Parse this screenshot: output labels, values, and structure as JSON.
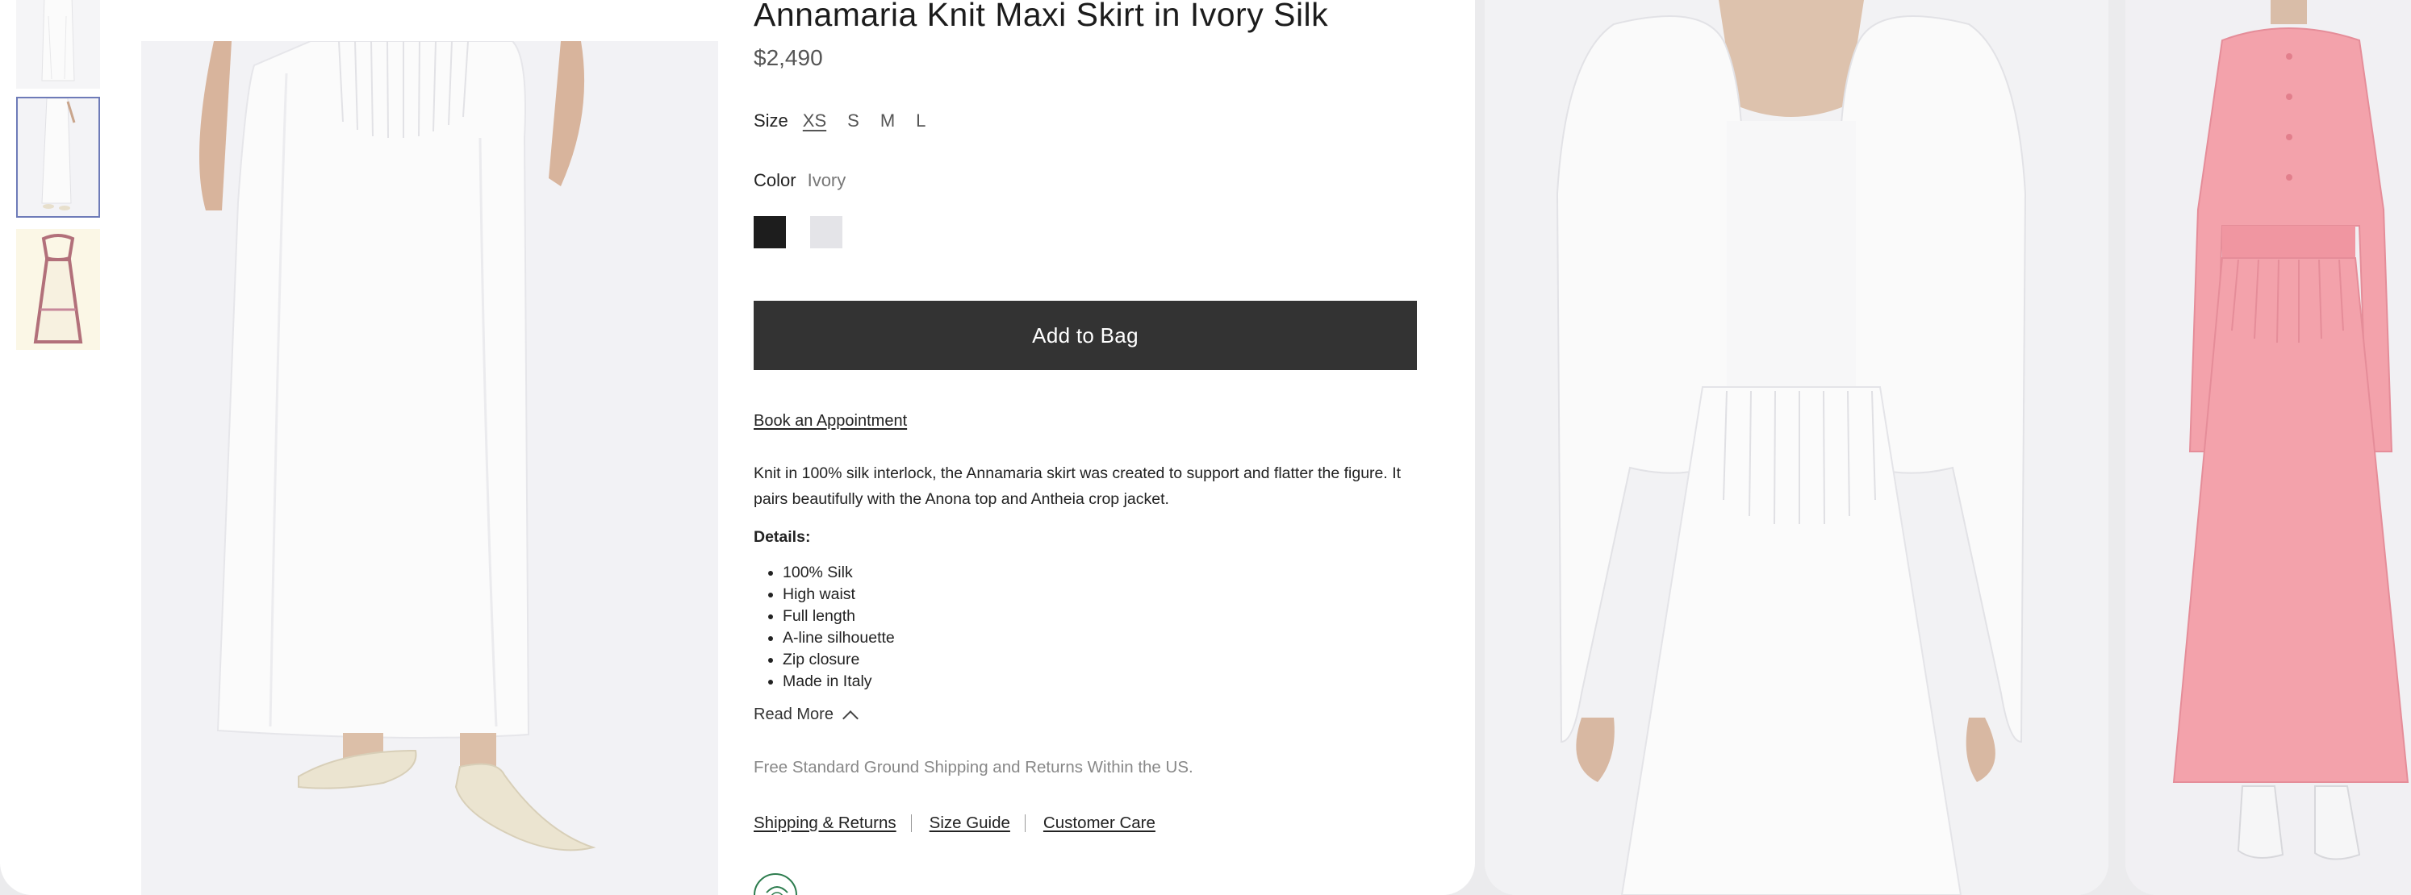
{
  "product": {
    "title": "Annamaria Knit Maxi Skirt in Ivory Silk",
    "price": "$2,490",
    "size_label": "Size",
    "sizes": [
      "XS",
      "S",
      "M",
      "L"
    ],
    "selected_size": "XS",
    "color_label": "Color",
    "color_value": "Ivory",
    "swatches": [
      {
        "name": "black",
        "hex": "#1d1d1d"
      },
      {
        "name": "ivory",
        "hex": "#e4e4e8"
      }
    ],
    "add_to_bag": "Add to Bag",
    "book_appointment": "Book an Appointment",
    "description": "Knit in 100% silk interlock, the Annamaria skirt was created to support and flatter the figure. It pairs beautifully with the Anona top and Antheia crop jacket.",
    "details_heading": "Details:",
    "details": [
      "100% Silk",
      "High waist",
      "Full length",
      "A-line silhouette",
      "Zip closure",
      "Made in Italy"
    ],
    "read_more": "Read More",
    "shipping_note": "Free Standard Ground Shipping and Returns Within the US."
  },
  "links": {
    "shipping_returns": "Shipping & Returns",
    "size_guide": "Size Guide",
    "customer_care": "Customer Care"
  },
  "colors": {
    "button_bg": "#333333",
    "thumb_selected_border": "#6e7bb8",
    "pink_dress": "#f19aa4"
  },
  "icons": {
    "read_more": "chevron-up-icon",
    "badge": "sustainability-badge-icon"
  }
}
